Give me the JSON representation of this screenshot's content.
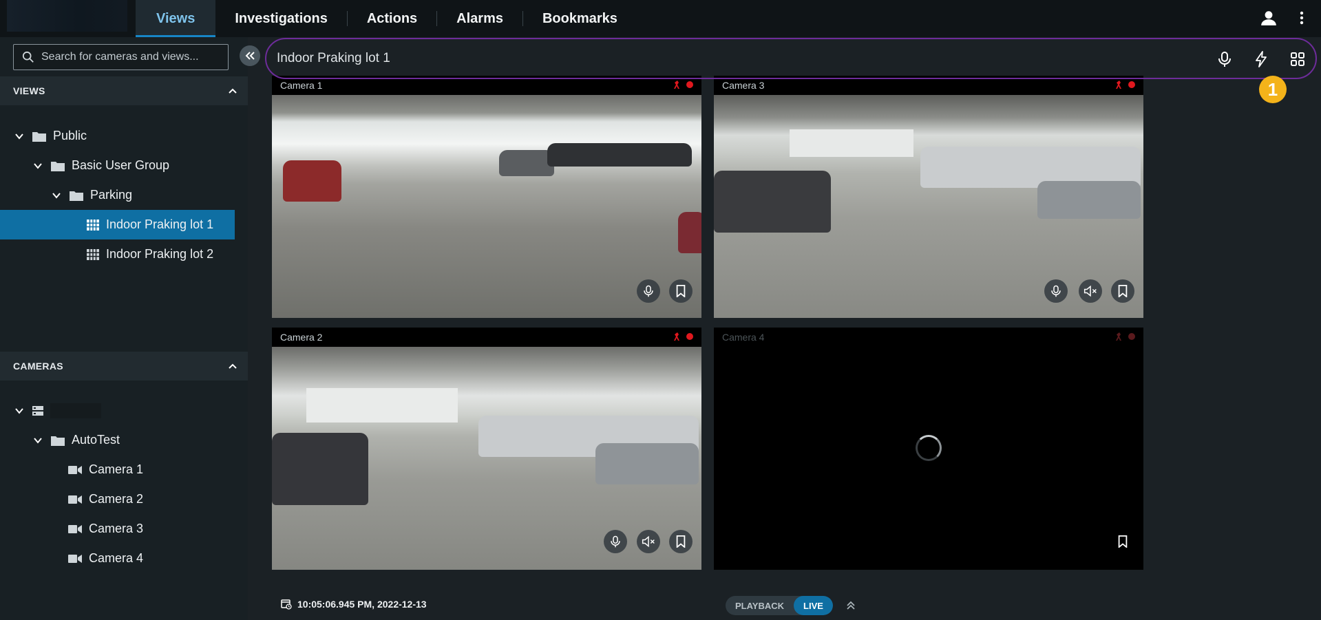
{
  "nav": {
    "tabs": [
      {
        "label": "Views",
        "active": true
      },
      {
        "label": "Investigations",
        "active": false
      },
      {
        "label": "Actions",
        "active": false
      },
      {
        "label": "Alarms",
        "active": false
      },
      {
        "label": "Bookmarks",
        "active": false
      }
    ],
    "icons": [
      "user-icon",
      "more-vertical-icon"
    ]
  },
  "sidebar": {
    "search_placeholder": "Search for cameras and views...",
    "views_header": "VIEWS",
    "views_tree": [
      {
        "label": "Public",
        "level": 0,
        "type": "folder"
      },
      {
        "label": "Basic User Group",
        "level": 1,
        "type": "folder"
      },
      {
        "label": "Parking",
        "level": 2,
        "type": "folder"
      },
      {
        "label": "Indoor Praking lot 1",
        "level": 3,
        "type": "view",
        "selected": true
      },
      {
        "label": "Indoor Praking lot 2",
        "level": 3,
        "type": "view",
        "selected": false
      }
    ],
    "cameras_header": "CAMERAS",
    "cameras_tree": [
      {
        "label": "",
        "level": 0,
        "type": "server"
      },
      {
        "label": "AutoTest",
        "level": 1,
        "type": "folder"
      },
      {
        "label": "Camera 1",
        "level": 2,
        "type": "camera"
      },
      {
        "label": "Camera 2",
        "level": 2,
        "type": "camera"
      },
      {
        "label": "Camera 3",
        "level": 2,
        "type": "camera"
      },
      {
        "label": "Camera 4",
        "level": 2,
        "type": "camera"
      }
    ]
  },
  "view": {
    "title": "Indoor Praking lot 1",
    "badge": "1",
    "header_icons": [
      "microphone-icon",
      "lightning-icon",
      "grid-layout-icon"
    ]
  },
  "tiles": [
    {
      "label": "Camera 1"
    },
    {
      "label": "Camera 3"
    },
    {
      "label": "Camera 2"
    },
    {
      "label": "Camera 4"
    }
  ],
  "footer": {
    "timestamp": "10:05:06.945 PM, 2022-12-13",
    "playback_label": "PLAYBACK",
    "live_label": "LIVE"
  },
  "colors": {
    "accent": "#1786c7",
    "selected": "#0f6fa3",
    "highlight_ring": "#6d2c9a",
    "badge": "#f4b31a",
    "recording": "#e0181e"
  }
}
